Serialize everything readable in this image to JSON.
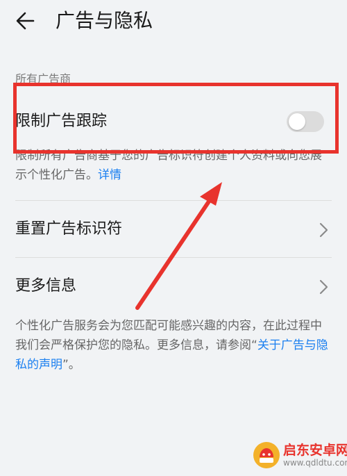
{
  "header": {
    "title": "广告与隐私",
    "back_icon": "arrow-left-icon"
  },
  "section": {
    "label": "所有广告商"
  },
  "limit_tracking": {
    "label": "限制广告跟踪",
    "toggle_on": false,
    "description": "限制所有广告商基于您的广告标识符创建个人资料或向您展示个性化广告。",
    "details_link": "详情"
  },
  "reset_ad_id": {
    "label": "重置广告标识符",
    "icon": "chevron-right-icon"
  },
  "more_info": {
    "label": "更多信息",
    "icon": "chevron-right-icon"
  },
  "footer_text": {
    "text_before": "个性化广告服务会为您匹配可能感兴趣的内容，在此过程中我们会严格保护您的隐私。更多信息，请参阅“",
    "link": "关于广告与隐私的声明",
    "text_after": "”。"
  },
  "watermark": {
    "name": "启东安卓网",
    "url": "www.qdldtu.com"
  },
  "colors": {
    "background": "#f1f3f5",
    "link": "#1a7ff0",
    "annotation_red": "#e8332d",
    "toggle_off": "#dcdcdc"
  }
}
